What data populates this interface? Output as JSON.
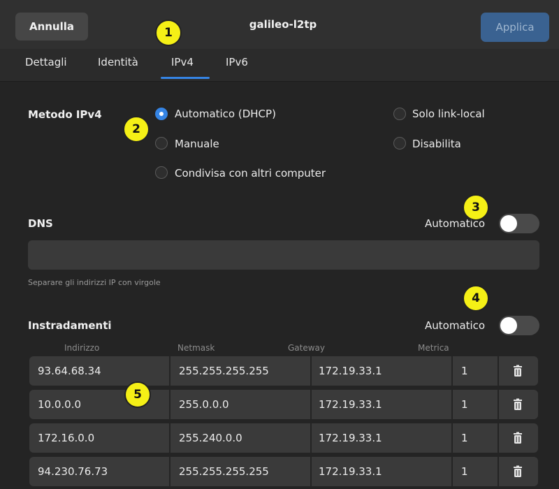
{
  "header": {
    "cancel_label": "Annulla",
    "title": "galileo-l2tp",
    "apply_label": "Applica"
  },
  "tabs": [
    {
      "label": "Dettagli",
      "active": false
    },
    {
      "label": "Identità",
      "active": false
    },
    {
      "label": "IPv4",
      "active": true
    },
    {
      "label": "IPv6",
      "active": false
    }
  ],
  "ipv4": {
    "method_label": "Metodo IPv4",
    "options": [
      {
        "label": "Automatico (DHCP)",
        "checked": true
      },
      {
        "label": "Manuale",
        "checked": false
      },
      {
        "label": "Condivisa con altri computer",
        "checked": false
      },
      {
        "label": "Solo link-local",
        "checked": false
      },
      {
        "label": "Disabilita",
        "checked": false
      }
    ]
  },
  "dns": {
    "label": "DNS",
    "auto_label": "Automatico",
    "auto_on": false,
    "value": "",
    "hint": "Separare gli indirizzi IP con virgole"
  },
  "routes": {
    "label": "Instradamenti",
    "auto_label": "Automatico",
    "auto_on": false,
    "columns": [
      "Indirizzo",
      "Netmask",
      "Gateway",
      "Metrica"
    ],
    "rows": [
      {
        "address": "93.64.68.34",
        "netmask": "255.255.255.255",
        "gateway": "172.19.33.1",
        "metric": "1"
      },
      {
        "address": "10.0.0.0",
        "netmask": "255.0.0.0",
        "gateway": "172.19.33.1",
        "metric": "1"
      },
      {
        "address": "172.16.0.0",
        "netmask": "255.240.0.0",
        "gateway": "172.19.33.1",
        "metric": "1"
      },
      {
        "address": "94.230.76.73",
        "netmask": "255.255.255.255",
        "gateway": "172.19.33.1",
        "metric": "1"
      }
    ]
  },
  "markers": [
    "1",
    "2",
    "3",
    "4",
    "5"
  ],
  "colors": {
    "accent": "#3584e4",
    "apply_button": "#3a6291",
    "marker": "#f5f016",
    "background": "#242424"
  }
}
